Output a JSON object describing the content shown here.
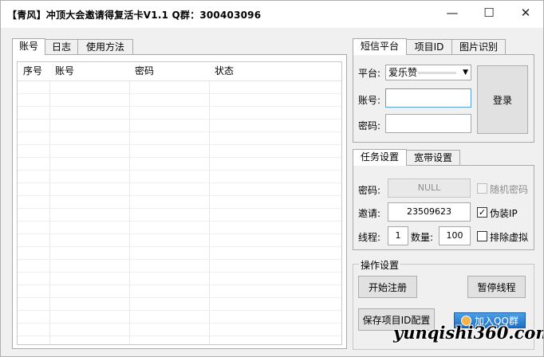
{
  "window": {
    "title": "【青风】冲顶大会邀请得复活卡V1.1  Q群：300403096",
    "min_symbol": "—",
    "max_symbol": "☐",
    "close_symbol": "✕"
  },
  "left_tabs": [
    "账号",
    "日志",
    "使用方法"
  ],
  "table": {
    "columns": [
      "序号",
      "账号",
      "密码",
      "状态"
    ],
    "rows": []
  },
  "sms_tabs": [
    "短信平台",
    "项目ID",
    "图片识别"
  ],
  "sms": {
    "platform_label": "平台:",
    "platform_value": "爱乐赞",
    "account_label": "账号:",
    "account_value": "",
    "password_label": "密码:",
    "password_value": "",
    "login_button": "登录"
  },
  "task_tabs": [
    "任务设置",
    "宽带设置"
  ],
  "task": {
    "password_label": "密码:",
    "password_value": "NULL",
    "random_password_label": "随机密码",
    "random_password_checked": false,
    "invite_label": "邀请:",
    "invite_value": "23509623",
    "fake_ip_label": "伪装IP",
    "fake_ip_checked": true,
    "thread_label": "线程:",
    "thread_value": "1",
    "quantity_label": "数量:",
    "quantity_value": "100",
    "exclude_virtual_label": "排除虚拟",
    "exclude_virtual_checked": false
  },
  "ops": {
    "group_label": "操作设置",
    "start_button": "开始注册",
    "pause_button": "暂停线程",
    "save_button": "保存项目ID配置",
    "join_qq_button": "加入QQ群"
  },
  "watermark": "yunqishi360.com",
  "colors": {
    "qq_button_top": "#4a9fe8",
    "qq_button_bottom": "#1e6fc4",
    "check_mark": "#000000"
  }
}
